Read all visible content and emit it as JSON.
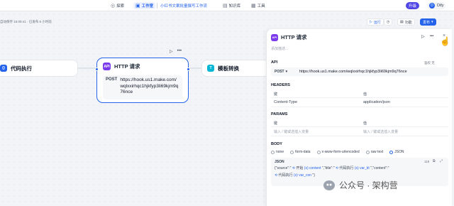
{
  "topbar": {
    "explore": "探索",
    "studio": "工作室",
    "app_name": "小红书文案批量撰写工作流",
    "knowledge": "知识库",
    "tools": "工具",
    "upgrade": "升级",
    "user_initial": "D",
    "user_name": "Dify"
  },
  "canvas_bar": {
    "autosave": "自动保存 15:09:41 · 已发布 6 小时前",
    "run": "运行",
    "features": "功能",
    "publish": "发布"
  },
  "nodes": {
    "code": "代码执行",
    "http_title": "HTTP 请求",
    "http_method": "POST",
    "http_url": "https://hook.us1.make.com/wqlxxirhqc1hjkfyp3li69kjm9q76nce",
    "template": "模板转换"
  },
  "panel": {
    "title": "HTTP 请求",
    "description_placeholder": "添加描述...",
    "api_label": "API",
    "auth_label": "鉴权 无",
    "method": "POST",
    "url": "https://hook.us1.make.com/wqlxxirhqc1hjkfyp3li69kjm9q76nce",
    "headers_label": "HEADERS",
    "key_col": "键",
    "value_col": "值",
    "header_key": "Content-Type",
    "header_value": "application/json",
    "params_label": "PARAMS",
    "key_placeholder": "输入 / 键或选插入变量",
    "value_placeholder": "输入 / 键或选插入变量",
    "body_label": "BODY",
    "body_options": [
      "none",
      "form-data",
      "x-www-form-urlencoded",
      "raw text",
      "JSON"
    ],
    "body_selected": "JSON",
    "json_label": "JSON",
    "char_count": "119",
    "json_line1_a": "{\"source\":\"",
    "json_line1_b": "开始",
    "json_line1_c": "content",
    "json_line1_d": "\",\"title\":\"",
    "json_line1_e": "代码执行",
    "json_line1_f": "var_tit",
    "json_line1_g": "\",\"content\":\"",
    "json_line2_a": "代码执行",
    "json_line2_b": "var_con",
    "json_line2_c": "\"}"
  },
  "watermark": {
    "text": "公众号 · 架构营"
  },
  "colors": {
    "accent": "#2563eb",
    "http_icon": "#7c3aed",
    "code_icon": "#2563eb",
    "template_icon": "#06b6d4",
    "upgrade": "#4f46e5"
  },
  "icons": [
    "compass-icon",
    "studio-icon",
    "book-icon",
    "toolbox-icon",
    "play-icon",
    "history-icon",
    "more-icon",
    "close-icon",
    "pointer-hand-icon",
    "wechat-icon"
  ]
}
